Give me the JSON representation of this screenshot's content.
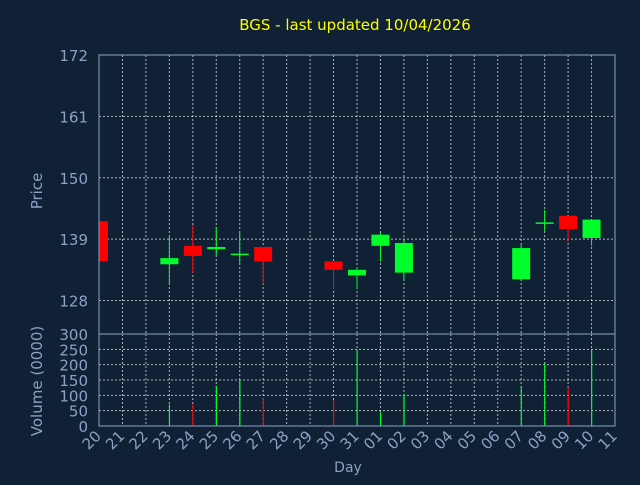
{
  "colors": {
    "background": "#102035",
    "title": "#ffff00",
    "axis_text": "#8aa3c2",
    "grid": "#e6e6e6",
    "up": "#00ff2a",
    "down": "#ff0000"
  },
  "chart_data": {
    "type": "candlestick",
    "title": "BGS - last updated 10/04/2026",
    "xlabel": "Day",
    "categories": [
      "20",
      "21",
      "22",
      "23",
      "24",
      "25",
      "26",
      "27",
      "28",
      "29",
      "30",
      "31",
      "01",
      "02",
      "03",
      "04",
      "05",
      "06",
      "07",
      "08",
      "09",
      "10",
      "11"
    ],
    "price_panel": {
      "ylabel": "Price",
      "ylim": [
        122,
        172
      ],
      "yticks": [
        172,
        161,
        150,
        139,
        128
      ],
      "grid": true,
      "candles": [
        {
          "day": "20",
          "open": 142.2,
          "high": 142.2,
          "low": 135.0,
          "close": 135.0
        },
        {
          "day": "23",
          "open": 134.5,
          "high": 139.5,
          "low": 131.0,
          "close": 135.6
        },
        {
          "day": "24",
          "open": 137.8,
          "high": 141.5,
          "low": 133.0,
          "close": 136.0
        },
        {
          "day": "25",
          "open": 137.2,
          "high": 141.2,
          "low": 136.0,
          "close": 137.6
        },
        {
          "day": "26",
          "open": 136.2,
          "high": 140.3,
          "low": 134.5,
          "close": 136.4
        },
        {
          "day": "27",
          "open": 137.6,
          "high": 137.6,
          "low": 131.0,
          "close": 135.0
        },
        {
          "day": "30",
          "open": 135.0,
          "high": 135.0,
          "low": 130.0,
          "close": 133.5
        },
        {
          "day": "31",
          "open": 132.5,
          "high": 134.0,
          "low": 130.0,
          "close": 133.5
        },
        {
          "day": "01",
          "open": 137.8,
          "high": 140.2,
          "low": 135.0,
          "close": 139.8
        },
        {
          "day": "02",
          "open": 133.0,
          "high": 139.0,
          "low": 131.5,
          "close": 138.3
        },
        {
          "day": "07",
          "open": 131.8,
          "high": 138.0,
          "low": 131.5,
          "close": 137.4
        },
        {
          "day": "08",
          "open": 142.0,
          "high": 144.2,
          "low": 140.5,
          "close": 142.0
        },
        {
          "day": "09",
          "open": 143.2,
          "high": 143.2,
          "low": 138.5,
          "close": 140.8
        },
        {
          "day": "10",
          "open": 139.2,
          "high": 142.5,
          "low": 137.8,
          "close": 142.5
        }
      ]
    },
    "volume_panel": {
      "ylabel": "Volume (0000)",
      "ylim": [
        0,
        300
      ],
      "yticks": [
        300,
        250,
        200,
        150,
        100,
        50,
        0
      ],
      "grid": true,
      "bars": [
        {
          "day": "23",
          "value": 70,
          "color": "up"
        },
        {
          "day": "24",
          "value": 70,
          "color": "down"
        },
        {
          "day": "25",
          "value": 130,
          "color": "up"
        },
        {
          "day": "26",
          "value": 150,
          "color": "up"
        },
        {
          "day": "27",
          "value": 90,
          "color": "down"
        },
        {
          "day": "30",
          "value": 85,
          "color": "down"
        },
        {
          "day": "31",
          "value": 250,
          "color": "up"
        },
        {
          "day": "01",
          "value": 45,
          "color": "up"
        },
        {
          "day": "02",
          "value": 105,
          "color": "up"
        },
        {
          "day": "07",
          "value": 130,
          "color": "up"
        },
        {
          "day": "08",
          "value": 205,
          "color": "up"
        },
        {
          "day": "09",
          "value": 125,
          "color": "down"
        },
        {
          "day": "10",
          "value": 250,
          "color": "up"
        }
      ]
    }
  }
}
